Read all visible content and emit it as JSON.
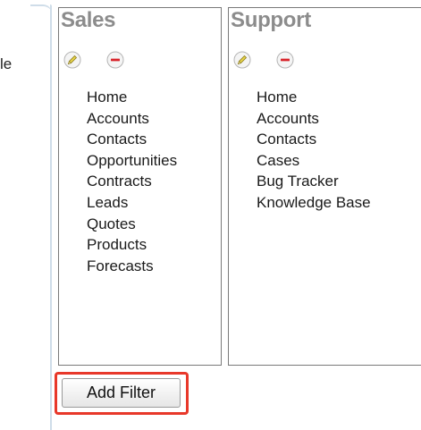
{
  "left_panel": {
    "partial_label": "le"
  },
  "groups": [
    {
      "title": "Sales",
      "items": [
        "Home",
        "Accounts",
        "Contacts",
        "Opportunities",
        "Contracts",
        "Leads",
        "Quotes",
        "Products",
        "Forecasts"
      ]
    },
    {
      "title": "Support",
      "items": [
        "Home",
        "Accounts",
        "Contacts",
        "Cases",
        "Bug Tracker",
        "Knowledge Base"
      ]
    }
  ],
  "icons": {
    "edit": "pencil-icon",
    "remove": "minus-circle-icon"
  },
  "colors": {
    "title_gray": "#8c8c8c",
    "remove_red": "#d8232a",
    "edit_yellow": "#e8d44a",
    "highlight_red": "#e8382a"
  },
  "add_filter": {
    "label": "Add Filter"
  }
}
